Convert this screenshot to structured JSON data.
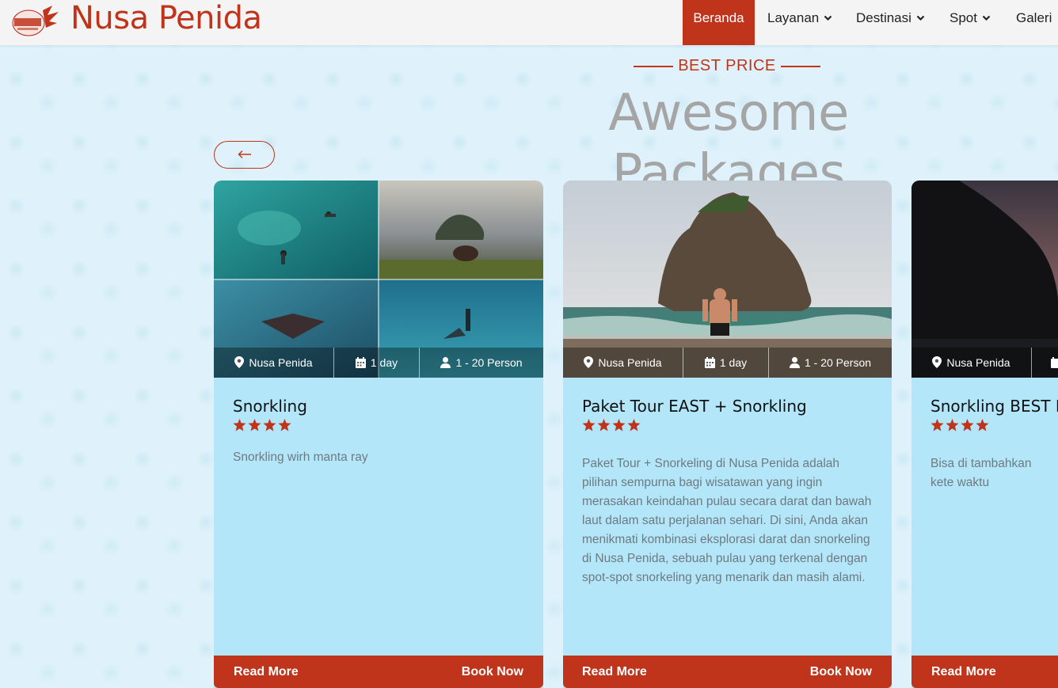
{
  "navbar": {
    "brand": "Nusa Penida",
    "items": [
      {
        "label": "Beranda",
        "active": true,
        "dropdown": false
      },
      {
        "label": "Layanan",
        "active": false,
        "dropdown": true
      },
      {
        "label": "Destinasi",
        "active": false,
        "dropdown": true
      },
      {
        "label": "Spot",
        "active": false,
        "dropdown": true
      },
      {
        "label": "Galeri",
        "active": false,
        "dropdown": false
      }
    ]
  },
  "section": {
    "subtitle": "BEST PRICE",
    "title": "Awesome Packages"
  },
  "packages": [
    {
      "title": "Snorkling",
      "location": "Nusa Penida",
      "duration": "1 day",
      "persons": "1 - 20 Person",
      "rating": 4,
      "description": "Snorkling wirh manta ray",
      "read_more": "Read More",
      "book_now": "Book Now"
    },
    {
      "title": "Paket Tour EAST + Snorkling",
      "location": "Nusa Penida",
      "duration": "1 day",
      "persons": "1 - 20 Person",
      "rating": 4,
      "description": "Paket Tour + Snorkeling di Nusa Penida adalah pilihan sempurna bagi wisatawan yang ingin merasakan keindahan pulau secara darat dan bawah laut dalam satu perjalanan sehari. Di sini, Anda akan menikmati kombinasi eksplorasi darat dan snorkeling di Nusa Penida, sebuah pulau yang terkenal dengan spot-spot snorkeling yang menarik dan masih alami.",
      "read_more": "Read More",
      "book_now": "Book Now"
    },
    {
      "title": "Snorkling BEST PR",
      "location": "Nusa Penida",
      "rating": 4,
      "description": "Bisa di tambahkan kete waktu",
      "read_more": "Read More"
    }
  ],
  "colors": {
    "accent": "#c0341b",
    "card_bg": "#b2e6f8",
    "page_bg": "#dff2fb",
    "title_gray": "#a5a5a5"
  },
  "icons": {
    "prev": "arrow-left-icon",
    "location": "map-pin-icon",
    "duration": "calendar-icon",
    "persons": "user-icon",
    "rating": "star-icon",
    "dropdown": "chevron-down-icon"
  }
}
